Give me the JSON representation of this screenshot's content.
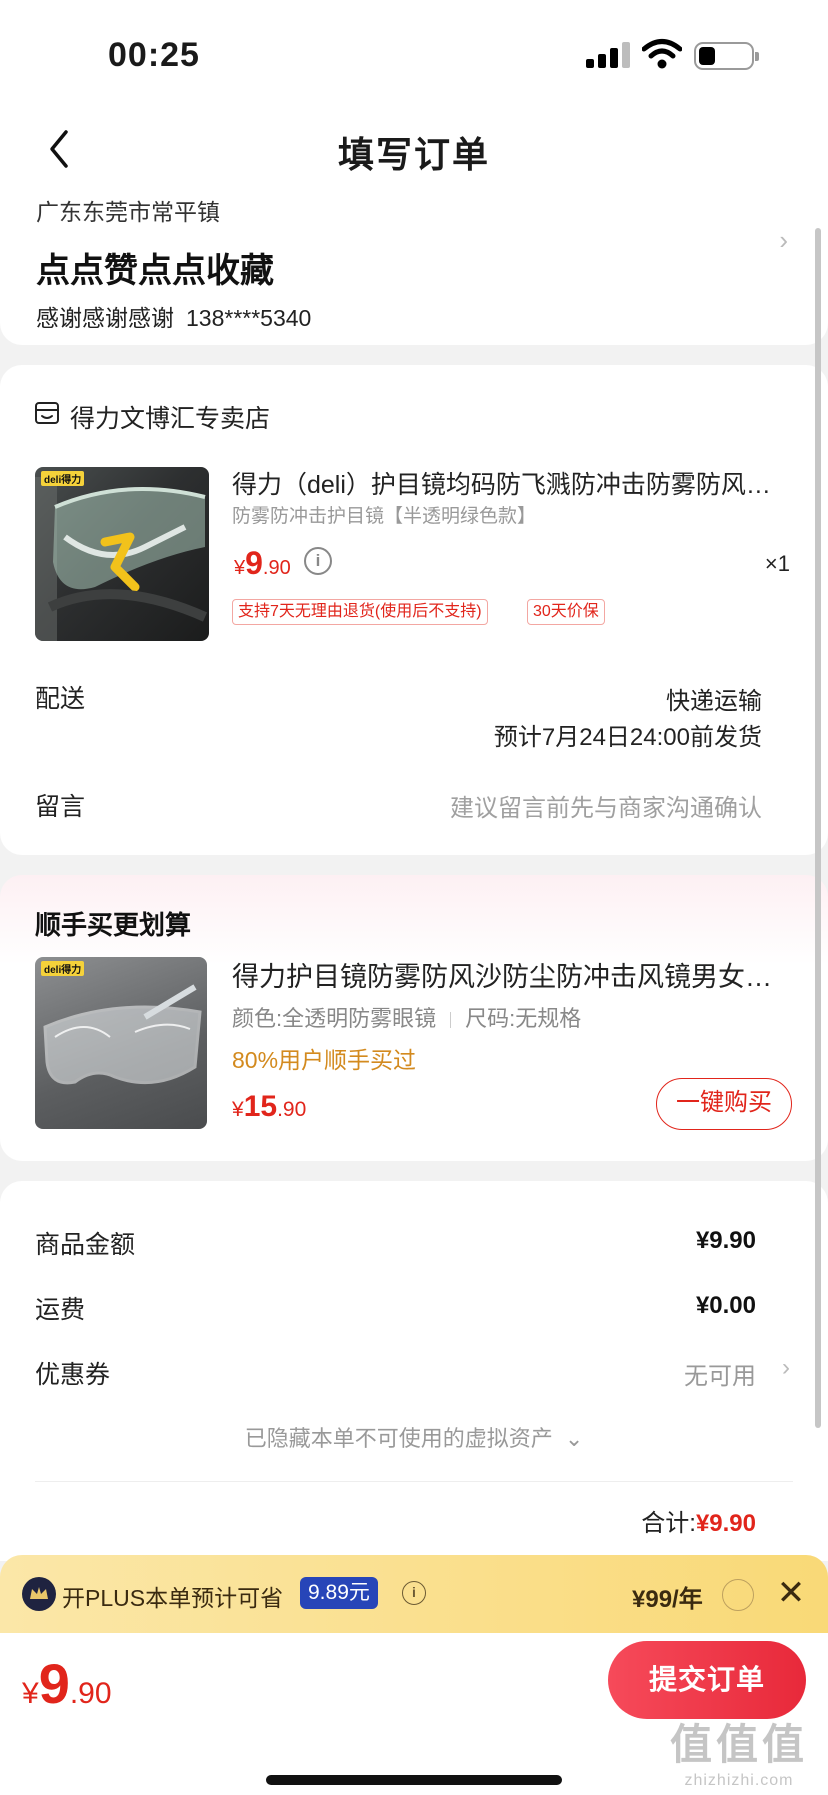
{
  "status": {
    "time": "00:25"
  },
  "nav": {
    "title": "填写订单"
  },
  "address": {
    "region": "广东东莞市常平镇",
    "detail": "点点赞点点收藏",
    "name": "感谢感谢感谢",
    "phone": "138****5340"
  },
  "order": {
    "shop_name": "得力文博汇专卖店",
    "product": {
      "brand_logo": "deli得力",
      "title": "得力（deli）护目镜均码防飞溅防冲击防雾防风…",
      "spec": "防雾防冲击护目镜【半透明绿色款】",
      "price_symbol": "¥",
      "price_int": "9",
      "price_dec": ".90",
      "quantity": "×1",
      "tags": [
        "支持7天无理由退货(使用后不支持)",
        "30天价保"
      ]
    },
    "delivery": {
      "label": "配送",
      "method": "快递运输",
      "eta": "预计7月24日24:00前发货"
    },
    "message": {
      "label": "留言",
      "placeholder": "建议留言前先与商家沟通确认"
    }
  },
  "addon": {
    "title": "顺手买更划算",
    "brand_logo": "deli得力",
    "name": "得力护目镜防雾防风沙防尘防冲击风镜男女…",
    "spec_color": "颜色:全透明防雾眼镜",
    "spec_size": "尺码:无规格",
    "buyers": "80%用户顺手买过",
    "price_symbol": "¥",
    "price_int": "15",
    "price_dec": ".90",
    "buy_label": "一键购买"
  },
  "summary": {
    "goods_label": "商品金额",
    "goods_value": "¥9.90",
    "shipping_label": "运费",
    "shipping_value": "¥0.00",
    "coupon_label": "优惠券",
    "coupon_value": "无可用",
    "hidden_assets": "已隐藏本单不可使用的虚拟资产",
    "total_label": "合计:",
    "total_value": "¥9.90"
  },
  "plus": {
    "text": "开PLUS本单预计可省",
    "save_amount": "9.89元",
    "price": "¥99/年"
  },
  "bottom": {
    "price_symbol": "¥",
    "price_int": "9",
    "price_dec": ".90",
    "submit_label": "提交订单",
    "watermark": "值值值",
    "watermark_sub": "zhizhizhi.com"
  },
  "colors": {
    "accent": "#e1251b",
    "plus_bar": "#f9d977",
    "plus_badge": "#2745b8",
    "buyers_text": "#d38a1e"
  }
}
